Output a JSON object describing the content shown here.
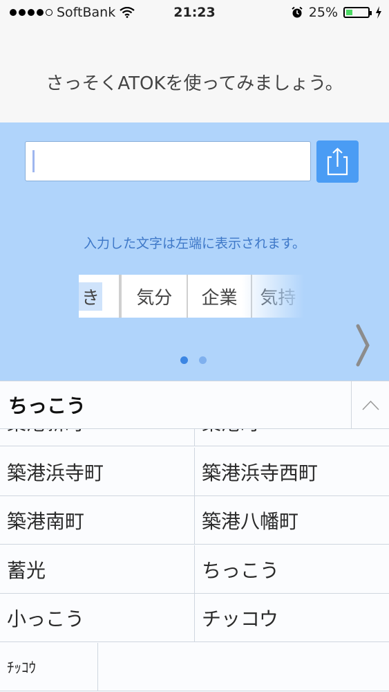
{
  "status_bar": {
    "carrier": "SoftBank",
    "time": "21:23",
    "battery": "25%",
    "battery_level": 0.25
  },
  "prompt": "さっそくATOKを使ってみましょう。",
  "demo": {
    "input_value": "",
    "hint": "入力した文字は左端に表示されます。",
    "candidates": [
      "き",
      "気分",
      "企業",
      "気持"
    ]
  },
  "reading": "ちっこう",
  "conversions": {
    "partial_row": [
      "築港新町",
      "築港町"
    ],
    "rows": [
      [
        "築港浜寺町",
        "築港浜寺西町"
      ],
      [
        "築港南町",
        "築港八幡町"
      ],
      [
        "蓄光",
        "ちっこう"
      ],
      [
        "小っこう",
        "チッコウ"
      ]
    ],
    "last": "ﾁｯｺｳ"
  },
  "colors": {
    "accent": "#4a9cf4",
    "demo_bg": "#b0d4fb",
    "hint": "#3e78c8"
  }
}
